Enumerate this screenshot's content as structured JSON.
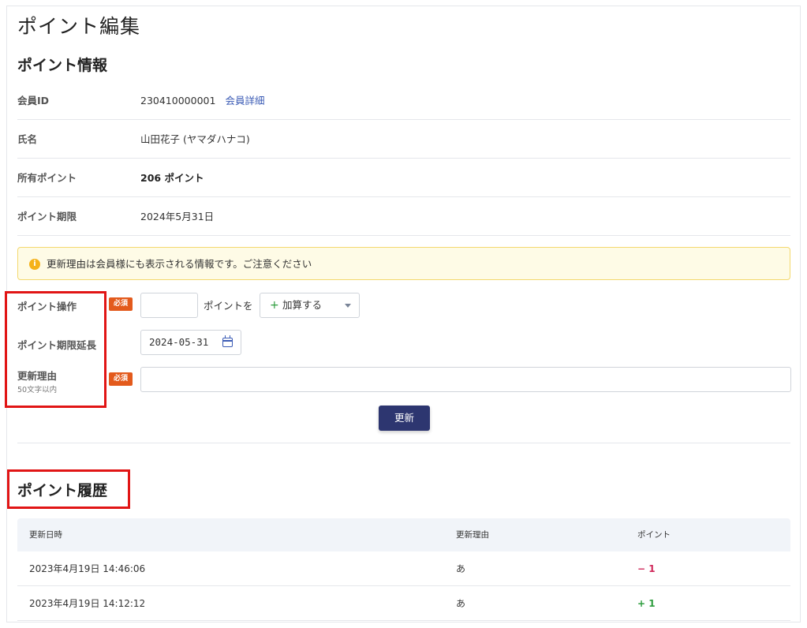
{
  "page": {
    "title": "ポイント編集"
  },
  "info": {
    "section_title": "ポイント情報",
    "member_id_label": "会員ID",
    "member_id": "230410000001",
    "member_detail_link": "会員詳細",
    "name_label": "氏名",
    "name": "山田花子 (ヤマダハナコ)",
    "points_label": "所有ポイント",
    "points": "206 ポイント",
    "expiry_label": "ポイント期限",
    "expiry": "2024年5月31日"
  },
  "notice": {
    "icon": "info-icon",
    "text": "更新理由は会員様にも表示される情報です。ご注意ください"
  },
  "form": {
    "operation_label": "ポイント操作",
    "required_badge": "必須",
    "points_value": "",
    "points_unit": "ポイントを",
    "operation_plus": "+",
    "operation_value": "加算する",
    "extend_label": "ポイント期限延長",
    "extend_date": "2024-05-31",
    "reason_label": "更新理由",
    "reason_sub": "50文字以内",
    "reason_value": "",
    "update_button": "更新"
  },
  "history": {
    "section_title": "ポイント履歴",
    "columns": [
      "更新日時",
      "更新理由",
      "ポイント"
    ],
    "rows": [
      {
        "datetime": "2023年4月19日 14:46:06",
        "reason": "あ",
        "points": "− 1"
      },
      {
        "datetime": "2023年4月19日 14:12:12",
        "reason": "あ",
        "points": "+ 1"
      }
    ]
  },
  "colors": {
    "accent": "#2d3670",
    "link": "#3b5bb5",
    "required": "#e35a1c",
    "minus": "#d0285a",
    "plus": "#2e9d3e",
    "highlight": "#e11515"
  }
}
